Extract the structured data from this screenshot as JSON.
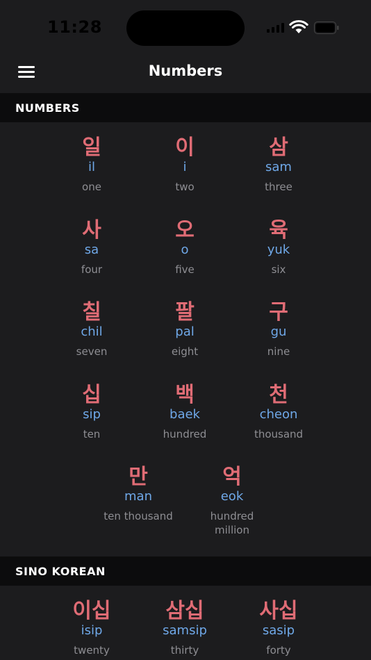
{
  "status_bar": {
    "time": "11:28"
  },
  "nav": {
    "title": "Numbers"
  },
  "sections": [
    {
      "header": "NUMBERS",
      "rows": [
        [
          {
            "hangul": "일",
            "roman": "il",
            "meaning": "one"
          },
          {
            "hangul": "이",
            "roman": "i",
            "meaning": "two"
          },
          {
            "hangul": "삼",
            "roman": "sam",
            "meaning": "three"
          }
        ],
        [
          {
            "hangul": "사",
            "roman": "sa",
            "meaning": "four"
          },
          {
            "hangul": "오",
            "roman": "o",
            "meaning": "five"
          },
          {
            "hangul": "육",
            "roman": "yuk",
            "meaning": "six"
          }
        ],
        [
          {
            "hangul": "칠",
            "roman": "chil",
            "meaning": "seven"
          },
          {
            "hangul": "팔",
            "roman": "pal",
            "meaning": "eight"
          },
          {
            "hangul": "구",
            "roman": "gu",
            "meaning": "nine"
          }
        ],
        [
          {
            "hangul": "십",
            "roman": "sip",
            "meaning": "ten"
          },
          {
            "hangul": "백",
            "roman": "baek",
            "meaning": "hundred"
          },
          {
            "hangul": "천",
            "roman": "cheon",
            "meaning": "thousand"
          }
        ],
        [
          {
            "hangul": "만",
            "roman": "man",
            "meaning": "ten thousand"
          },
          {
            "hangul": "억",
            "roman": "eok",
            "meaning": "hundred million"
          }
        ]
      ]
    },
    {
      "header": "SINO KOREAN",
      "rows": [
        [
          {
            "hangul": "이십",
            "roman": "isip",
            "meaning": "twenty"
          },
          {
            "hangul": "삼십",
            "roman": "samsip",
            "meaning": "thirty"
          },
          {
            "hangul": "사십",
            "roman": "sasip",
            "meaning": "forty"
          }
        ]
      ]
    }
  ]
}
